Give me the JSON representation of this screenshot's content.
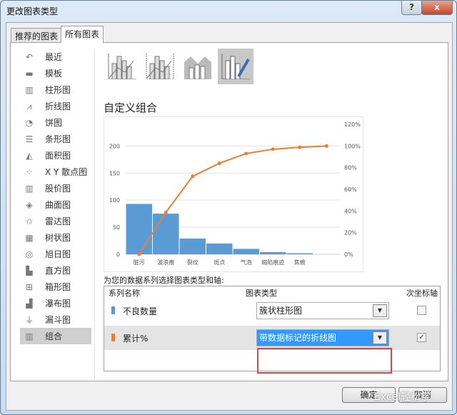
{
  "window": {
    "title": "更改图表类型",
    "help": "?",
    "close": "x"
  },
  "tabs": [
    {
      "label": "推荐的图表"
    },
    {
      "label": "所有图表"
    }
  ],
  "sidebar": {
    "items": [
      {
        "label": "最近",
        "icon": "↶"
      },
      {
        "label": "模板",
        "icon": "▬"
      },
      {
        "label": "柱形图",
        "icon": "▥"
      },
      {
        "label": "折线图",
        "icon": "⩘"
      },
      {
        "label": "饼图",
        "icon": "◔"
      },
      {
        "label": "条形图",
        "icon": "☰"
      },
      {
        "label": "面积图",
        "icon": "◭"
      },
      {
        "label": "X Y 散点图",
        "icon": "⁘"
      },
      {
        "label": "股价图",
        "icon": "▥"
      },
      {
        "label": "曲面图",
        "icon": "◈"
      },
      {
        "label": "雷达图",
        "icon": "✩"
      },
      {
        "label": "树状图",
        "icon": "▦"
      },
      {
        "label": "旭日图",
        "icon": "◎"
      },
      {
        "label": "直方图",
        "icon": "▙"
      },
      {
        "label": "箱形图",
        "icon": "⊞"
      },
      {
        "label": "瀑布图",
        "icon": "▟"
      },
      {
        "label": "漏斗图",
        "icon": "⏚"
      },
      {
        "label": "组合",
        "icon": "▥"
      }
    ],
    "selected": 17
  },
  "section_title": "自定义组合",
  "chart_data": {
    "type": "bar+line",
    "categories": [
      "脏污",
      "波浪痕",
      "裂纹",
      "斑点",
      "气泡",
      "缩陷痕迹",
      "焦痕",
      ""
    ],
    "series": [
      {
        "name": "不良数量",
        "type": "bar",
        "axis": "primary",
        "values": [
          93,
          75,
          29,
          20,
          10,
          4,
          2,
          0
        ]
      },
      {
        "name": "累计%",
        "type": "line",
        "axis": "secondary",
        "values": [
          0,
          38.7,
          72,
          84,
          93,
          97,
          98.7,
          100
        ]
      }
    ],
    "y_ticks": [
      "0",
      "50",
      "100",
      "150",
      "200"
    ],
    "ylim": [
      0,
      240
    ],
    "y2_ticks": [
      "0%",
      "20%",
      "40%",
      "60%",
      "80%",
      "100%",
      "120%"
    ],
    "y2lim": [
      0,
      120
    ],
    "colors": {
      "bar": "#5b9bd5",
      "line": "#ed7d31"
    }
  },
  "series_prompt": "为您的数据系列选择图表类型和轴:",
  "grid": {
    "headers": {
      "name": "系列名称",
      "type": "图表类型",
      "axis": "次坐标轴"
    },
    "rows": [
      {
        "name": "不良数量",
        "color": "#5b9bd5",
        "type": "簇状柱形图",
        "secondary": false
      },
      {
        "name": "累计%",
        "color": "#ed7d31",
        "type": "带数据标记的折线图",
        "secondary": true
      }
    ]
  },
  "buttons": {
    "ok": "确定",
    "cancel": "取消"
  },
  "watermark": "Excel轻松学"
}
